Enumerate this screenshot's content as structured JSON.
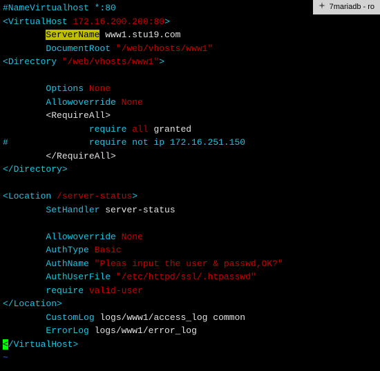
{
  "tab": {
    "label": "7mariadb - ro",
    "icon": "server-icon"
  },
  "lines": [
    {
      "tokens": [
        {
          "t": "#NameVirtualhost *:80",
          "c": "cyan"
        }
      ]
    },
    {
      "tokens": [
        {
          "t": "<",
          "c": "cyan"
        },
        {
          "t": "VirtualHost ",
          "c": "cyan"
        },
        {
          "t": "172.16.200.200:80",
          "c": "red"
        },
        {
          "t": ">",
          "c": "cyan"
        }
      ]
    },
    {
      "tokens": [
        {
          "t": "        ",
          "c": "white"
        },
        {
          "t": "ServerName",
          "c": "hl"
        },
        {
          "t": " www1.stu19.com",
          "c": "white"
        }
      ]
    },
    {
      "tokens": [
        {
          "t": "        ",
          "c": "white"
        },
        {
          "t": "DocumentRoot",
          "c": "cyan"
        },
        {
          "t": " ",
          "c": "white"
        },
        {
          "t": "\"/web/vhosts/www1\"",
          "c": "red"
        }
      ]
    },
    {
      "tokens": [
        {
          "t": "<",
          "c": "cyan"
        },
        {
          "t": "Directory ",
          "c": "cyan"
        },
        {
          "t": "\"/web/vhosts/www1\"",
          "c": "red"
        },
        {
          "t": ">",
          "c": "cyan"
        }
      ]
    },
    {
      "tokens": [
        {
          "t": "",
          "c": "white"
        }
      ]
    },
    {
      "tokens": [
        {
          "t": "        ",
          "c": "white"
        },
        {
          "t": "Options",
          "c": "cyan"
        },
        {
          "t": " ",
          "c": "white"
        },
        {
          "t": "None",
          "c": "red"
        }
      ]
    },
    {
      "tokens": [
        {
          "t": "        ",
          "c": "white"
        },
        {
          "t": "Allowoverride",
          "c": "cyan"
        },
        {
          "t": " ",
          "c": "white"
        },
        {
          "t": "None",
          "c": "red"
        }
      ]
    },
    {
      "tokens": [
        {
          "t": "        <RequireAll>",
          "c": "white"
        }
      ]
    },
    {
      "tokens": [
        {
          "t": "                ",
          "c": "white"
        },
        {
          "t": "require",
          "c": "cyan"
        },
        {
          "t": " ",
          "c": "white"
        },
        {
          "t": "all",
          "c": "red"
        },
        {
          "t": " granted",
          "c": "white"
        }
      ]
    },
    {
      "tokens": [
        {
          "t": "#               require not ip 172.16.251.150",
          "c": "cyan"
        }
      ]
    },
    {
      "tokens": [
        {
          "t": "        </RequireAll>",
          "c": "white"
        }
      ]
    },
    {
      "tokens": [
        {
          "t": "</",
          "c": "cyan"
        },
        {
          "t": "Directory",
          "c": "cyan"
        },
        {
          "t": ">",
          "c": "cyan"
        }
      ]
    },
    {
      "tokens": [
        {
          "t": "",
          "c": "white"
        }
      ]
    },
    {
      "tokens": [
        {
          "t": "<",
          "c": "cyan"
        },
        {
          "t": "Location ",
          "c": "cyan"
        },
        {
          "t": "/server-status",
          "c": "red"
        },
        {
          "t": ">",
          "c": "cyan"
        }
      ]
    },
    {
      "tokens": [
        {
          "t": "        ",
          "c": "white"
        },
        {
          "t": "SetHandler",
          "c": "cyan"
        },
        {
          "t": " server-status",
          "c": "white"
        }
      ]
    },
    {
      "tokens": [
        {
          "t": "",
          "c": "white"
        }
      ]
    },
    {
      "tokens": [
        {
          "t": "        ",
          "c": "white"
        },
        {
          "t": "Allowoverride",
          "c": "cyan"
        },
        {
          "t": " ",
          "c": "white"
        },
        {
          "t": "None",
          "c": "red"
        }
      ]
    },
    {
      "tokens": [
        {
          "t": "        ",
          "c": "white"
        },
        {
          "t": "AuthType",
          "c": "cyan"
        },
        {
          "t": " ",
          "c": "white"
        },
        {
          "t": "Basic",
          "c": "red"
        }
      ]
    },
    {
      "tokens": [
        {
          "t": "        ",
          "c": "white"
        },
        {
          "t": "AuthName",
          "c": "cyan"
        },
        {
          "t": " ",
          "c": "white"
        },
        {
          "t": "\"Pleas input the user & passwd,OK?\"",
          "c": "red"
        }
      ]
    },
    {
      "tokens": [
        {
          "t": "        ",
          "c": "white"
        },
        {
          "t": "AuthUserFile",
          "c": "cyan"
        },
        {
          "t": " ",
          "c": "white"
        },
        {
          "t": "\"/etc/httpd/ssl/.htpasswd\"",
          "c": "red"
        }
      ]
    },
    {
      "tokens": [
        {
          "t": "        ",
          "c": "white"
        },
        {
          "t": "require",
          "c": "cyan"
        },
        {
          "t": " ",
          "c": "white"
        },
        {
          "t": "valid-user",
          "c": "red"
        }
      ]
    },
    {
      "tokens": [
        {
          "t": "</",
          "c": "cyan"
        },
        {
          "t": "Location",
          "c": "cyan"
        },
        {
          "t": ">",
          "c": "cyan"
        }
      ]
    },
    {
      "tokens": [
        {
          "t": "        ",
          "c": "white"
        },
        {
          "t": "CustomLog",
          "c": "cyan"
        },
        {
          "t": " logs/www1/access_log common",
          "c": "white"
        }
      ]
    },
    {
      "tokens": [
        {
          "t": "        ",
          "c": "white"
        },
        {
          "t": "ErrorLog",
          "c": "cyan"
        },
        {
          "t": " logs/www1/error_log",
          "c": "white"
        }
      ]
    },
    {
      "tokens": [
        {
          "t": "<",
          "c": "cursor"
        },
        {
          "t": "/",
          "c": "cyan"
        },
        {
          "t": "VirtualHost",
          "c": "cyan"
        },
        {
          "t": ">",
          "c": "cyan"
        }
      ]
    },
    {
      "tokens": [
        {
          "t": "~",
          "c": "tilde"
        }
      ]
    }
  ]
}
